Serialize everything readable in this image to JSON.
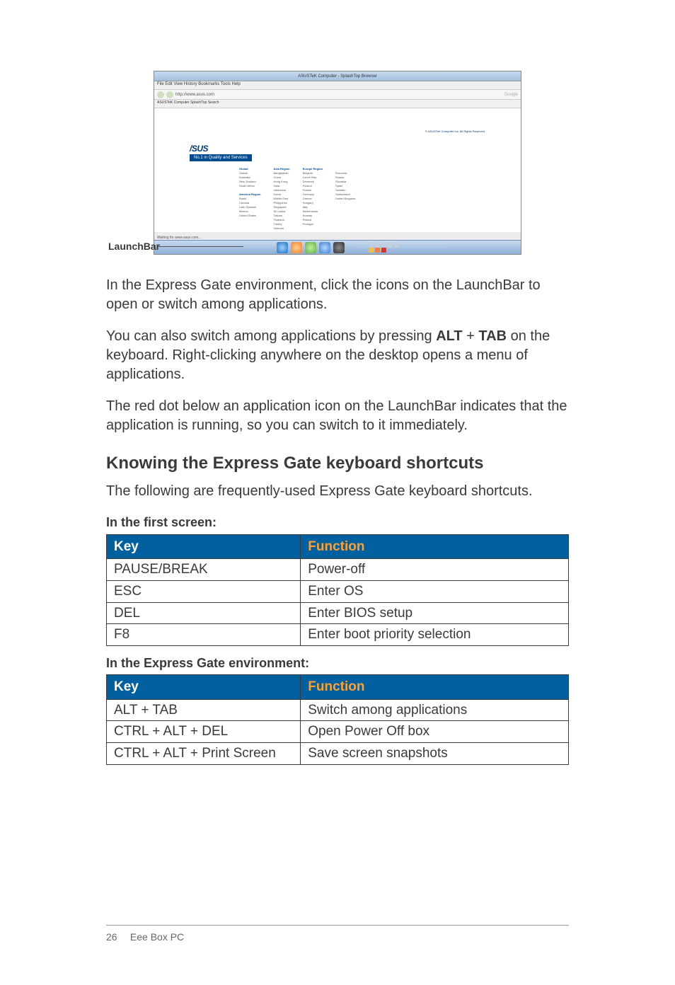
{
  "screenshot": {
    "window_title": "ASUSTeK Computer - SplashTop Browser",
    "menu": "File  Edit  View  History  Bookmarks  Tools  Help",
    "url": "http://www.asus.com",
    "tabs": "ASUSTeK Computer  SplashTop  Search",
    "asus": "/SUS",
    "tagline": "No.1 in Quality and Services",
    "copyright": "© ASUSTeK Computer Inc. All Rights Reserved.",
    "status": "Waiting for www.asus.com...",
    "search_hint": "Google",
    "regions": {
      "col1_h": "Global",
      "col1": [
        "Global",
        "Australia",
        "New Zealand",
        "South Africa",
        "",
        "America Region",
        "Brasil",
        "Canada",
        "Latin Spanish",
        "Mexico",
        "United States"
      ],
      "col2_h": "Asia Region",
      "col2": [
        "Bangladesh",
        "China",
        "Hong Kong",
        "India",
        "Indonesia",
        "Korea",
        "Middle East",
        "Philippines",
        "Singapore",
        "Sri Lanka",
        "Taiwan",
        "Thailand",
        "Turkey",
        "Vietnam"
      ],
      "col3_h": "Europe Region",
      "col3": [
        "Belgium",
        "Czech Rep.",
        "Denmark",
        "Finland",
        "France",
        "Germany",
        "Greece",
        "Hungary",
        "Italy",
        "Netherlands",
        "Norway",
        "Poland",
        "Portugal"
      ],
      "col4": [
        "Romania",
        "Russia",
        "Slovakia",
        "Spain",
        "Sweden",
        "Switzerland",
        "United Kingdom"
      ]
    }
  },
  "launchbar_label": "LaunchBar",
  "para1": "In the Express Gate environment, click the icons on the LaunchBar to open or switch among applications.",
  "para2_a": "You can also switch among applications by pressing ",
  "para2_b": "ALT",
  "para2_c": " + ",
  "para2_d": "TAB",
  "para2_e": " on the keyboard. Right-clicking anywhere on the desktop opens a menu of applications.",
  "para3": "The red dot below an application icon on the LaunchBar indicates that the application is running, so you can switch to it immediately.",
  "heading": "Knowing the Express Gate keyboard shortcuts",
  "heading_sub": "The following are frequently-used Express Gate keyboard shortcuts.",
  "table1": {
    "caption": "In the first screen:",
    "head_key": "Key",
    "head_fn": "Function",
    "rows": [
      {
        "k": "PAUSE/BREAK",
        "f": "Power-off"
      },
      {
        "k": "ESC",
        "f": "Enter OS"
      },
      {
        "k": "DEL",
        "f": "Enter BIOS setup"
      },
      {
        "k": "F8",
        "f": "Enter boot priority selection"
      }
    ]
  },
  "table2": {
    "caption": "In the Express Gate environment:",
    "head_key": "Key",
    "head_fn": "Function",
    "rows": [
      {
        "k": "ALT + TAB",
        "f": "Switch among applications"
      },
      {
        "k": "CTRL + ALT + DEL",
        "f": "Open Power Off box"
      },
      {
        "k": "CTRL + ALT + Print Screen",
        "f": "Save screen snapshots"
      }
    ]
  },
  "footer": {
    "page": "26",
    "title": "Eee Box PC"
  }
}
